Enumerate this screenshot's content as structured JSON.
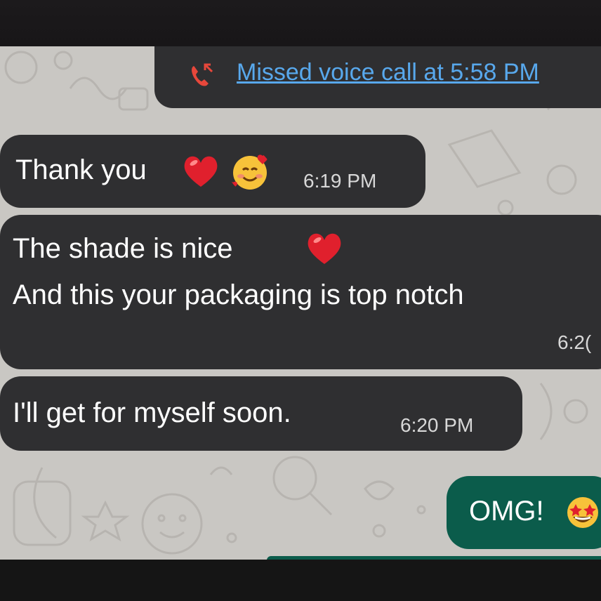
{
  "call": {
    "text": "Missed voice call at 5:58 PM",
    "icon": "missed-call-icon",
    "color": "#58a8ec"
  },
  "messages": [
    {
      "text": "Thank you",
      "time": "6:19 PM",
      "emojis": [
        "red-heart-icon",
        "smiling-face-with-hearts-icon"
      ]
    },
    {
      "line1": "The shade is nice",
      "line2": "And this your packaging is top notch",
      "time": "6:2(",
      "emojis": [
        "red-heart-icon"
      ]
    },
    {
      "text": "I'll get for myself soon.",
      "time": "6:20 PM"
    }
  ],
  "sent": {
    "text": "OMG!",
    "emojis": [
      "star-struck-icon"
    ]
  },
  "colors": {
    "incoming_bubble": "#2f2f31",
    "outgoing_bubble": "#0b5c4b",
    "background": "#c9c7c3",
    "heart": "#e0202d"
  }
}
